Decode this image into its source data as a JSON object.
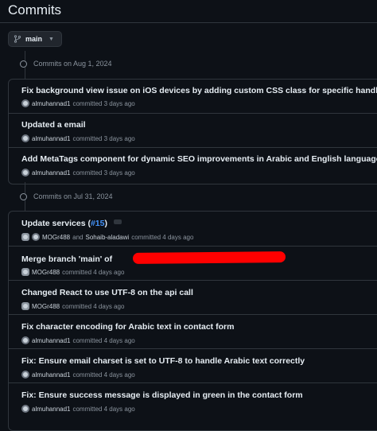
{
  "page": {
    "title": "Commits"
  },
  "branch": {
    "label": "main"
  },
  "groups": [
    {
      "date_label": "Commits on Aug 1, 2024",
      "commits": [
        {
          "message": "Fix background view issue on iOS devices by adding custom CSS class for specific handling",
          "author": "almuhannad1",
          "meta": "committed 3 days ago"
        },
        {
          "message": "Updated a email",
          "author": "almuhannad1",
          "meta": "committed 3 days ago"
        },
        {
          "message": "Add MetaTags component for dynamic SEO improvements in Arabic and English languages",
          "author": "almuhannad1",
          "meta": "committed 3 days ago"
        }
      ]
    },
    {
      "date_label": "Commits on Jul 31, 2024",
      "commits": [
        {
          "message": "Update services (",
          "pr": "#15",
          "message_end": ")",
          "author": "MOGr488",
          "author_joiner": "and",
          "coauthor": "Sohaib-aladawi",
          "meta": "committed 4 days ago"
        },
        {
          "message": "Merge branch 'main' of",
          "author": "MOGr488",
          "meta": "committed 4 days ago"
        },
        {
          "message": "Changed React to use UTF-8 on the api call",
          "author": "MOGr488",
          "meta": "committed 4 days ago"
        },
        {
          "message": "Fix character encoding for Arabic text in contact form",
          "author": "almuhannad1",
          "meta": "committed 4 days ago"
        },
        {
          "message": "Fix: Ensure email charset is set to UTF-8 to handle Arabic text correctly",
          "author": "almuhannad1",
          "meta": "committed 4 days ago"
        },
        {
          "message": "Fix: Ensure success message is displayed in green in the contact form",
          "author": "almuhannad1",
          "meta": "committed 4 days ago"
        }
      ]
    }
  ],
  "colors": {
    "background": "#0d1117",
    "border": "#30363d",
    "link": "#4493f8",
    "redaction": "#ff0000"
  }
}
